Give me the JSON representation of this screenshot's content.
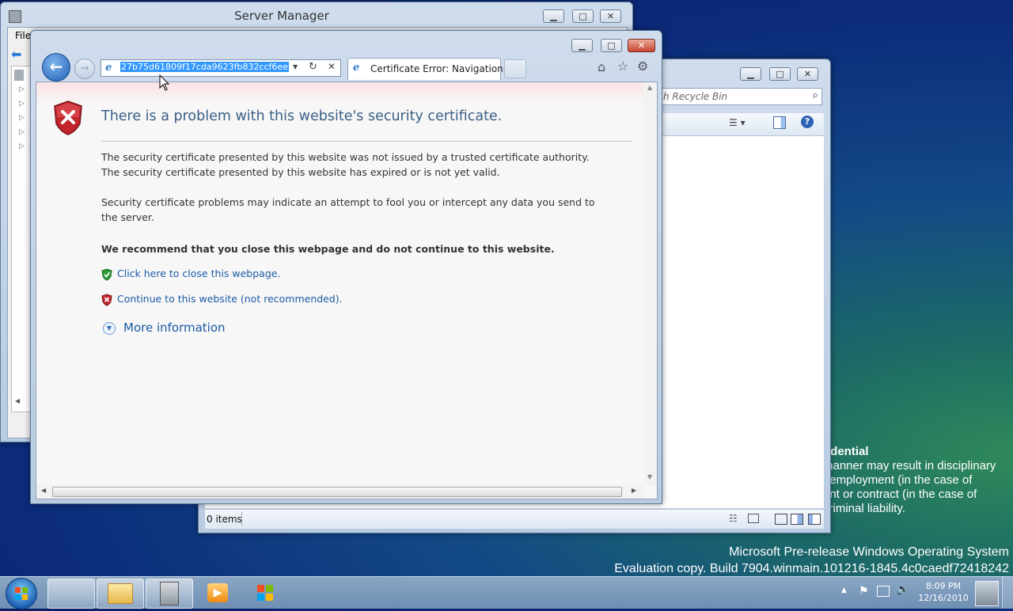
{
  "server_manager": {
    "title": "Server Manager",
    "menu_file": "File"
  },
  "explorer": {
    "search_placeholder": "h Recycle Bin",
    "status_items": "0 items"
  },
  "ie": {
    "address": "27b75d61809f17cda9623fb832ccf6ee",
    "tab_title": "Certificate Error: Navigation ...",
    "heading": "There is a problem with this website's security certificate.",
    "line1": "The security certificate presented by this website was not issued by a trusted certificate authority.",
    "line2": "The security certificate presented by this website has expired or is not yet valid.",
    "para2": "Security certificate problems may indicate an attempt to fool you or intercept any data you send to the server.",
    "recommend": "We recommend that you close this webpage and do not continue to this website.",
    "close_link": "Click here to close this webpage.",
    "continue_link": "Continue to this website (not recommended).",
    "more_info": "More information"
  },
  "desktop": {
    "confidential_title": "fidential",
    "confidential_lines": [
      "manner may result in disciplinary",
      "f employment (in the case of",
      "ent or contract (in the case of",
      " criminal liability."
    ],
    "watermark_line1": "Microsoft Pre-release Windows Operating System",
    "watermark_line2": "Evaluation copy. Build 7904.winmain.101216-1845.4c0caedf72418242"
  },
  "taskbar": {
    "time": "8:09 PM",
    "date": "12/16/2010"
  },
  "colors": {
    "accent_link": "#1a5aa6",
    "error_red": "#c0262c",
    "ok_green": "#2e9a3a"
  }
}
